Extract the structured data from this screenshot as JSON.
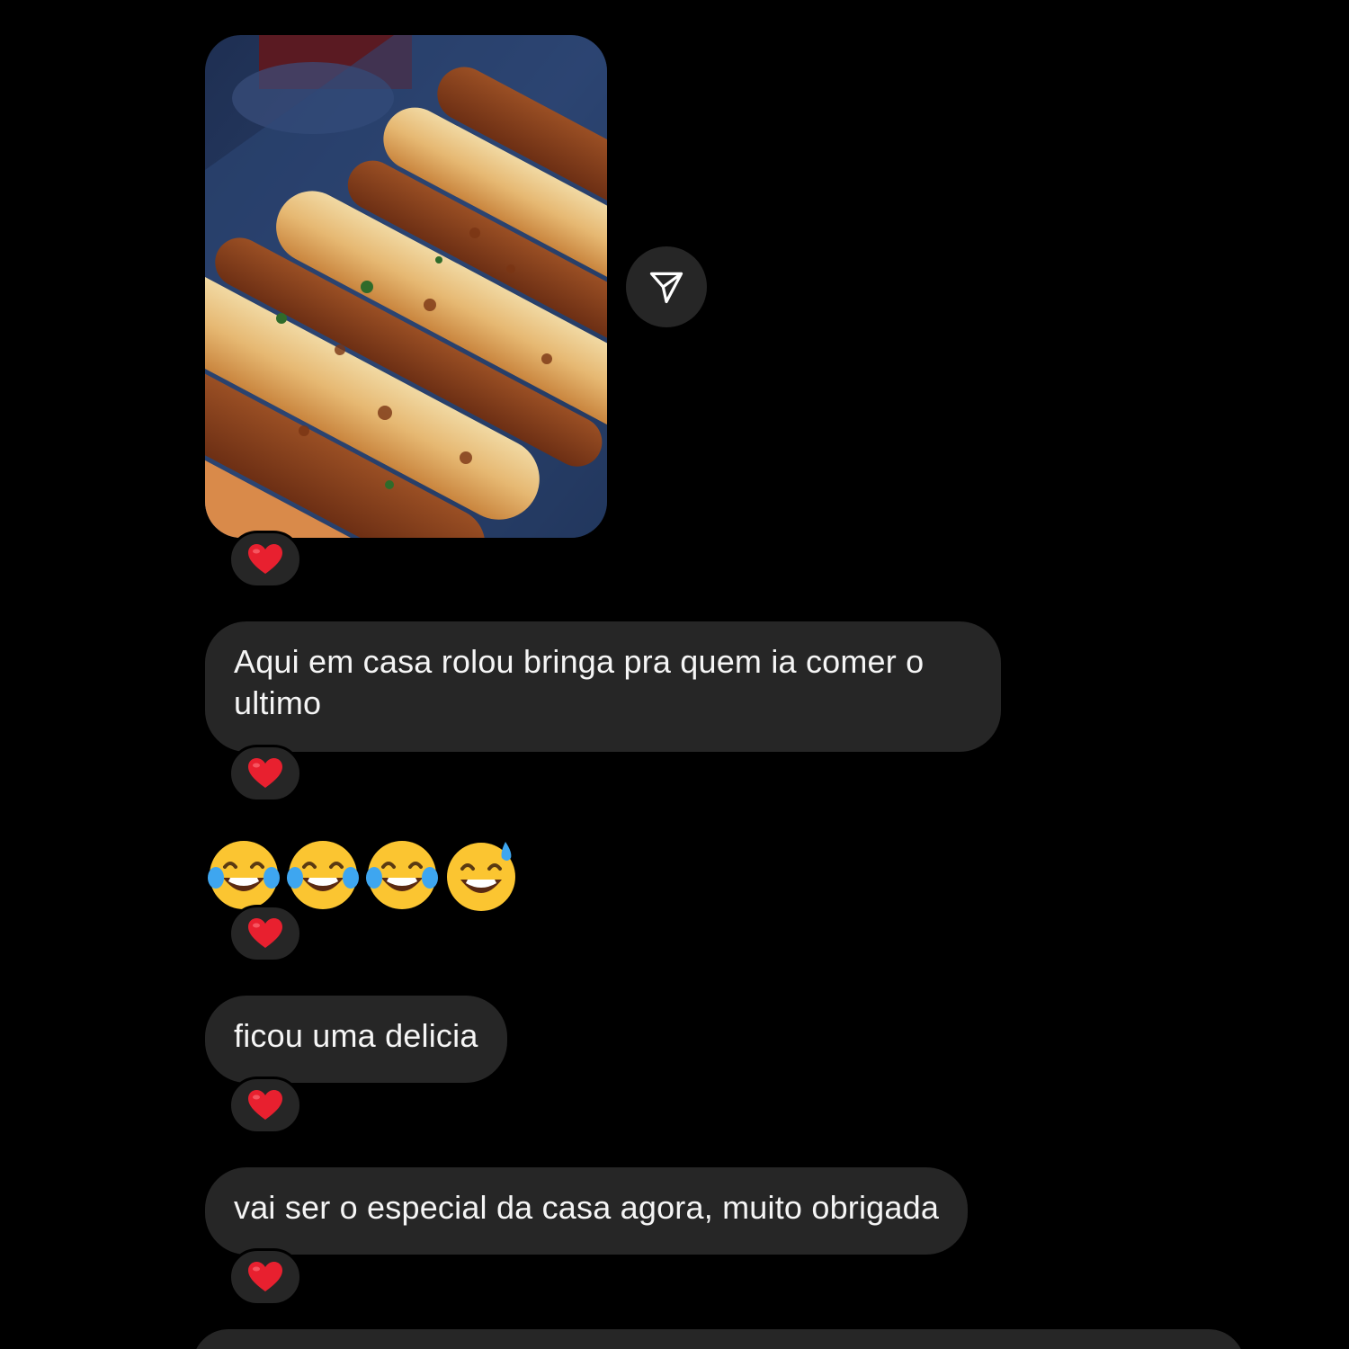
{
  "messages": {
    "m1": {
      "text": "Aqui em casa rolou bringa pra quem ia comer o ultimo"
    },
    "m2": {
      "emojis": [
        "😂",
        "😂",
        "😂",
        "😅"
      ]
    },
    "m3": {
      "text": "ficou uma delicia"
    },
    "m4": {
      "text": "vai ser o especial da casa agora, muito obrigada"
    }
  },
  "reactions": {
    "emoji": "heart"
  },
  "colors": {
    "background": "#000000",
    "bubble": "#262626",
    "text": "#f5f5f5",
    "heart": "#e8202f"
  }
}
